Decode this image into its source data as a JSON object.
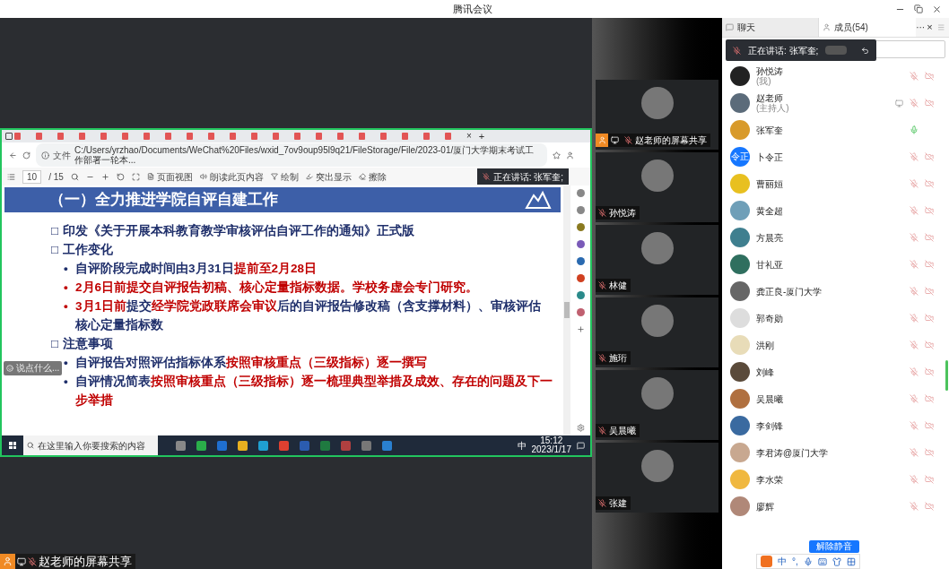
{
  "window": {
    "title": "腾讯会议"
  },
  "shared_screen": {
    "browser": {
      "active_tab_close": "×",
      "new_tab": "+",
      "address_label": "文件",
      "address": "C:/Users/yrzhao/Documents/WeChat%20Files/wxid_7ov9oup95l9q21/FileStorage/File/2023-01/厦门大学期末考试工作部署一轮本..."
    },
    "pdf_toolbar": {
      "page": "10",
      "page_total": "/ 15",
      "buttons": [
        "页面视图",
        "朗读此页内容",
        "绘制",
        "突出显示",
        "擦除"
      ]
    },
    "speaking_toast": "正在讲话: 张军奎;",
    "slide": {
      "title": "（一）全力推进学院自评自建工作",
      "lines": [
        {
          "marker": "□",
          "segments": [
            {
              "text": "印发《关于开展本科教育教学审核评估自评工作的通知》正式版",
              "emphasis": false
            }
          ]
        },
        {
          "marker": "□",
          "segments": [
            {
              "text": "工作变化",
              "emphasis": false
            }
          ]
        },
        {
          "marker": "•",
          "segments": [
            {
              "text": "自评阶段完成时间由3月31日",
              "emphasis": false
            },
            {
              "text": "提前至2月28日",
              "emphasis": true
            }
          ]
        },
        {
          "marker": "•",
          "segments": [
            {
              "text": "2月6日前提交自评报告初稿、核心定量指标数据。学校务虚会专门研究。",
              "emphasis": true
            }
          ]
        },
        {
          "marker": "•",
          "segments": [
            {
              "text": "3月1日前",
              "emphasis": true
            },
            {
              "text": "提交",
              "emphasis": false
            },
            {
              "text": "经学院党政联席会审议",
              "emphasis": true
            },
            {
              "text": "后的自评报告修改稿（含支撑材料）、审核评估核心定量指标数",
              "emphasis": false
            }
          ]
        },
        {
          "marker": "□",
          "segments": [
            {
              "text": "注意事项",
              "emphasis": false
            }
          ]
        },
        {
          "marker": "•",
          "segments": [
            {
              "text": "自评报告对照评估指标体系",
              "emphasis": false
            },
            {
              "text": "按照审核重点（三级指标）逐一撰写",
              "emphasis": true
            }
          ]
        },
        {
          "marker": "•",
          "segments": [
            {
              "text": "自评情况简表",
              "emphasis": false
            },
            {
              "text": "按照审核重点（三级指标）逐一梳理典型举措及成效、存在的问题及下一步举措",
              "emphasis": true
            }
          ]
        }
      ]
    },
    "chat_input": {
      "placeholder": "说点什么..."
    },
    "taskbar": {
      "search_placeholder": "在这里输入你要搜索的内容",
      "ime": "中",
      "time": "15:12",
      "date": "2023/1/17"
    }
  },
  "share_label": "赵老师的屏幕共享",
  "video_tiles": [
    {
      "name": "赵老师的屏幕共享",
      "sharing": true
    },
    {
      "name": "孙悦涛",
      "sharing": false
    },
    {
      "name": "林健",
      "sharing": false
    },
    {
      "name": "施珩",
      "sharing": false
    },
    {
      "name": "吴晨曦",
      "sharing": false
    },
    {
      "name": "张建",
      "sharing": false
    }
  ],
  "panel": {
    "tabs": [
      {
        "label": "聊天",
        "selected": false
      },
      {
        "label": "成员(54)",
        "selected": true
      }
    ],
    "more": "···",
    "close": "×",
    "speaking_toast": "正在讲话: 张军奎;",
    "members": [
      {
        "name": "孙悦涛",
        "role": "(我)",
        "muted": true,
        "camera_off": true,
        "sharing": false
      },
      {
        "name": "赵老师",
        "role": "(主持人)",
        "muted": true,
        "camera_off": true,
        "sharing": true
      },
      {
        "name": "张军奎",
        "muted": false,
        "camera_off": false,
        "sharing": false
      },
      {
        "name": "卜令正",
        "avatar_text": "令正",
        "muted": true,
        "camera_off": true,
        "sharing": false
      },
      {
        "name": "曹丽姮",
        "muted": true,
        "camera_off": true,
        "sharing": false
      },
      {
        "name": "黄全超",
        "muted": true,
        "camera_off": true,
        "sharing": false
      },
      {
        "name": "方晨亮",
        "muted": true,
        "camera_off": true,
        "sharing": false
      },
      {
        "name": "甘礼亚",
        "muted": true,
        "camera_off": true,
        "sharing": false
      },
      {
        "name": "龚正良-厦门大学",
        "muted": true,
        "camera_off": true,
        "sharing": false
      },
      {
        "name": "郭奇勋",
        "muted": true,
        "camera_off": true,
        "sharing": false
      },
      {
        "name": "洪刚",
        "muted": true,
        "camera_off": true,
        "sharing": false
      },
      {
        "name": "刘峰",
        "muted": true,
        "camera_off": true,
        "sharing": false
      },
      {
        "name": "吴晨曦",
        "muted": true,
        "camera_off": true,
        "sharing": false
      },
      {
        "name": "李剑锋",
        "muted": true,
        "camera_off": true,
        "sharing": false
      },
      {
        "name": "李君涛@厦门大学",
        "muted": true,
        "camera_off": true,
        "sharing": false
      },
      {
        "name": "李水荣",
        "muted": true,
        "camera_off": true,
        "sharing": false
      },
      {
        "name": "廖辉",
        "muted": true,
        "camera_off": true,
        "sharing": false
      }
    ],
    "unmute_button": "解除静音",
    "ime_bar": {
      "lang": "中",
      "punct": "°,"
    }
  }
}
